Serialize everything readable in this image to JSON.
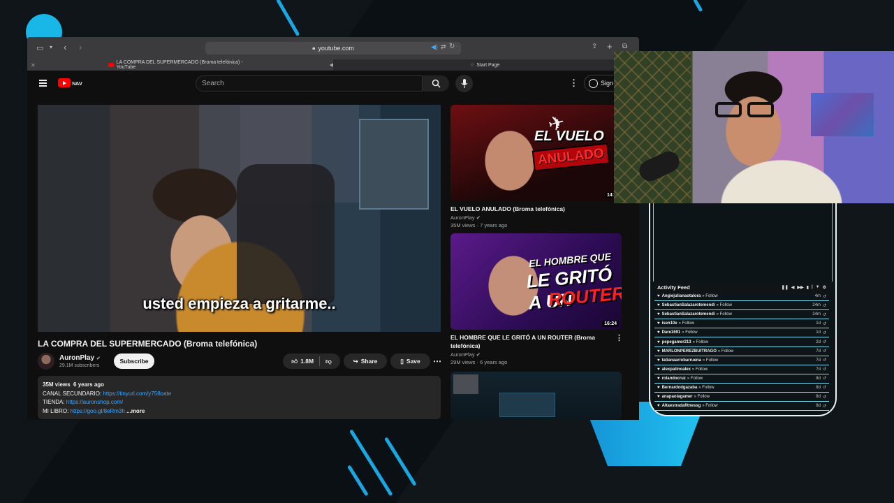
{
  "colors": {
    "accent": "#1aa6e0",
    "youtube_red": "#ff0000",
    "link": "#3ea6ff"
  },
  "browser": {
    "url": "youtube.com",
    "tabs": [
      {
        "label": "LA COMPRA DEL SUPERMERCADO (Broma telefónica) - YouTube",
        "active": true
      },
      {
        "label": "Start Page",
        "active": false
      }
    ]
  },
  "youtube": {
    "search_placeholder": "Search",
    "sign_in_label": "Sign",
    "video": {
      "subtitle": "usted empieza a gritarme..",
      "title": "LA COMPRA DEL SUPERMERCADO (Broma telefónica)",
      "channel": "AuronPlay",
      "subscribers": "29.1M subscribers",
      "subscribe_label": "Subscribe",
      "likes": "1.8M",
      "share_label": "Share",
      "save_label": "Save",
      "description": {
        "views": "35M views",
        "age": "6 years ago",
        "line1_label": "CANAL SECUNDARIO: ",
        "line1_link": "https://tinyurl.com/y758oate",
        "line2_label": "TIENDA: ",
        "line2_link": "https://auronshop.com/",
        "line3_label": "MI LIBRO: ",
        "line3_link": "https://goo.gl/8eRm3h",
        "more_label": "...more"
      }
    },
    "recommendations": [
      {
        "title": "EL VUELO ANULADO (Broma telefónica)",
        "channel": "AuronPlay",
        "views": "35M views",
        "age": "7 years ago",
        "duration": "14:5",
        "thumb_text_1": "EL VUELO",
        "thumb_text_2": "ANULADO"
      },
      {
        "title": "EL HOMBRE QUE LE GRITÓ A UN ROUTER (Broma telefónica)",
        "channel": "AuronPlay",
        "views": "29M views",
        "age": "6 years ago",
        "duration": "16:24",
        "thumb_text_1": "EL HOMBRE QUE",
        "thumb_text_2": "LE GRITÓ A UN",
        "thumb_text_3": "ROUTER"
      }
    ]
  },
  "activity_feed": {
    "title": "Activity Feed",
    "entries": [
      {
        "user": "Angiejulianaotalora",
        "action": "» Follow",
        "time": "4m"
      },
      {
        "user": "SebastianSalazarotemendi",
        "action": "» Follow",
        "time": "24m"
      },
      {
        "user": "SebastianSalazarotemendi",
        "action": "» Follow",
        "time": "24m"
      },
      {
        "user": "isen10e",
        "action": "» Follow",
        "time": "1d"
      },
      {
        "user": "Dare1691",
        "action": "» Follow",
        "time": "1d"
      },
      {
        "user": "pepegamer213",
        "action": "» Follow",
        "time": "2d"
      },
      {
        "user": "MARLONPEREZBUITRAGO",
        "action": "» Follow",
        "time": "7d"
      },
      {
        "user": "tatianaarrebarruena",
        "action": "» Follow",
        "time": "7d"
      },
      {
        "user": "alexpatinoalex",
        "action": "» Follow",
        "time": "7d"
      },
      {
        "user": "rolandocruz",
        "action": "» Follow",
        "time": "8d"
      },
      {
        "user": "Bernardodgazaba",
        "action": "» Follow",
        "time": "8d"
      },
      {
        "user": "anapaolagamer",
        "action": "» Follow",
        "time": "8d"
      },
      {
        "user": "Altaestradafitnessg",
        "action": "» Follow",
        "time": "8d"
      }
    ]
  }
}
